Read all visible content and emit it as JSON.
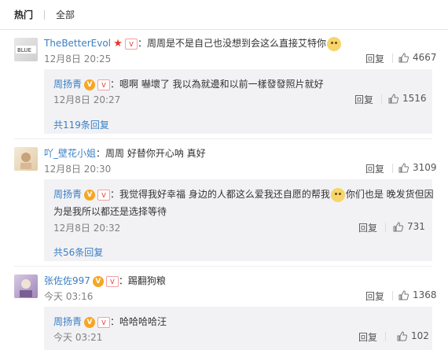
{
  "tabs": {
    "hot": "热门",
    "all": "全部"
  },
  "comments": [
    {
      "user": "TheBetterEvol",
      "text": "：周周是不是自己也没想到会这么直接艾特你",
      "time": "12月8日 20:25",
      "reply": "回复",
      "likes": "4667",
      "replies": [
        {
          "user": "周扬青",
          "text": "：嗯啊 嚇壞了 我以為就邊和以前一樣發發照片就好",
          "time": "12月8日 20:27",
          "reply": "回复",
          "likes": "1516"
        }
      ],
      "more": "共119条回复"
    },
    {
      "user": "吖_壁花小姐",
      "text": "：周周 好替你开心呐 真好",
      "time": "12月8日 20:30",
      "reply": "回复",
      "likes": "3109",
      "replies": [
        {
          "user": "周扬青",
          "text": "：我觉得我好幸福 身边的人都这么爱我还自愿的帮我",
          "text2": "你们也是 晚发货但因",
          "line2": "为是我所以都还是选择等待",
          "time": "12月8日 20:32",
          "reply": "回复",
          "likes": "731"
        }
      ],
      "more": "共56条回复"
    },
    {
      "user": "张佐佐997",
      "text": "：踢翻狗粮",
      "time": "今天 03:16",
      "reply": "回复",
      "likes": "1368",
      "replies": [
        {
          "user": "周扬青",
          "text": "：哈哈哈哈汪",
          "time": "今天 03:21",
          "reply": "回复",
          "likes": "102"
        }
      ]
    }
  ],
  "colors": {
    "link": "#3b7fc4",
    "subbox": "#f2f2f5"
  }
}
